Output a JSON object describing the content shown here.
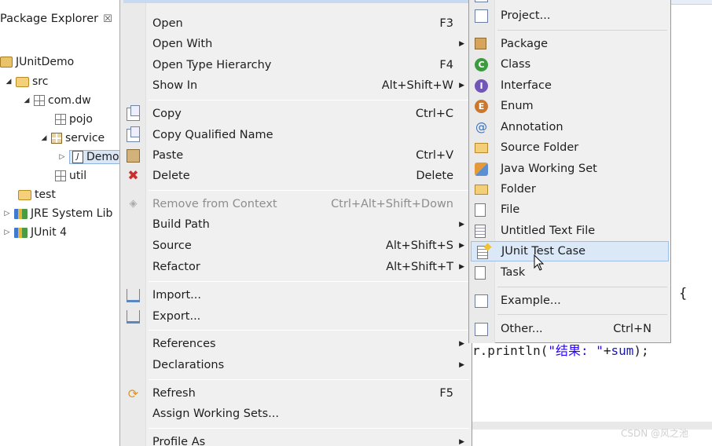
{
  "explorer": {
    "title": "Package Explorer",
    "close_glyph": "☒",
    "nodes": {
      "project": "JUnitDemo",
      "src": "src",
      "pkg_main": "com.dw",
      "pkg_pojo": "pojo",
      "pkg_service": "service",
      "demo_file": "Demo",
      "pkg_util": "util",
      "test": "test",
      "jre": "JRE System Lib",
      "junit": "JUnit 4"
    }
  },
  "menu": {
    "items": [
      {
        "label": "Open",
        "accel": "F3"
      },
      {
        "label": "Open With",
        "accel": ""
      },
      {
        "label": "Open Type Hierarchy",
        "accel": "F4"
      },
      {
        "label": "Show In",
        "accel": "Alt+Shift+W"
      },
      {
        "label": "Copy",
        "accel": "Ctrl+C"
      },
      {
        "label": "Copy Qualified Name",
        "accel": ""
      },
      {
        "label": "Paste",
        "accel": "Ctrl+V"
      },
      {
        "label": "Delete",
        "accel": "Delete"
      },
      {
        "label": "Remove from Context",
        "accel": "Ctrl+Alt+Shift+Down"
      },
      {
        "label": "Build Path",
        "accel": ""
      },
      {
        "label": "Source",
        "accel": "Alt+Shift+S"
      },
      {
        "label": "Refactor",
        "accel": "Alt+Shift+T"
      },
      {
        "label": "Import...",
        "accel": ""
      },
      {
        "label": "Export...",
        "accel": ""
      },
      {
        "label": "References",
        "accel": ""
      },
      {
        "label": "Declarations",
        "accel": ""
      },
      {
        "label": "Refresh",
        "accel": "F5"
      },
      {
        "label": "Assign Working Sets...",
        "accel": ""
      },
      {
        "label": "Profile As",
        "accel": ""
      }
    ]
  },
  "submenu": {
    "items": [
      {
        "label": "Project...",
        "accel": ""
      },
      {
        "label": "Package",
        "accel": ""
      },
      {
        "label": "Class",
        "accel": ""
      },
      {
        "label": "Interface",
        "accel": ""
      },
      {
        "label": "Enum",
        "accel": ""
      },
      {
        "label": "Annotation",
        "accel": ""
      },
      {
        "label": "Source Folder",
        "accel": ""
      },
      {
        "label": "Java Working Set",
        "accel": ""
      },
      {
        "label": "Folder",
        "accel": ""
      },
      {
        "label": "File",
        "accel": ""
      },
      {
        "label": "Untitled Text File",
        "accel": ""
      },
      {
        "label": "JUnit Test Case",
        "accel": ""
      },
      {
        "label": "Task",
        "accel": ""
      },
      {
        "label": "Example...",
        "accel": ""
      },
      {
        "label": "Other...",
        "accel": "Ctrl+N"
      }
    ]
  },
  "code": {
    "brace": "{",
    "line_prefix": "r.println(",
    "line_string": "\"结果: \"",
    "line_plus": "+",
    "line_var": "sum",
    "line_suffix": ");"
  },
  "watermark": "CSDN @风之池",
  "colors": {
    "menu_bg": "#f0f0f0",
    "highlight": "#dbe8f8",
    "class_icon": "#3d9a3d",
    "interface_icon": "#7156b8",
    "enum_icon": "#c9782e",
    "delete_icon": "#d12b2b"
  }
}
